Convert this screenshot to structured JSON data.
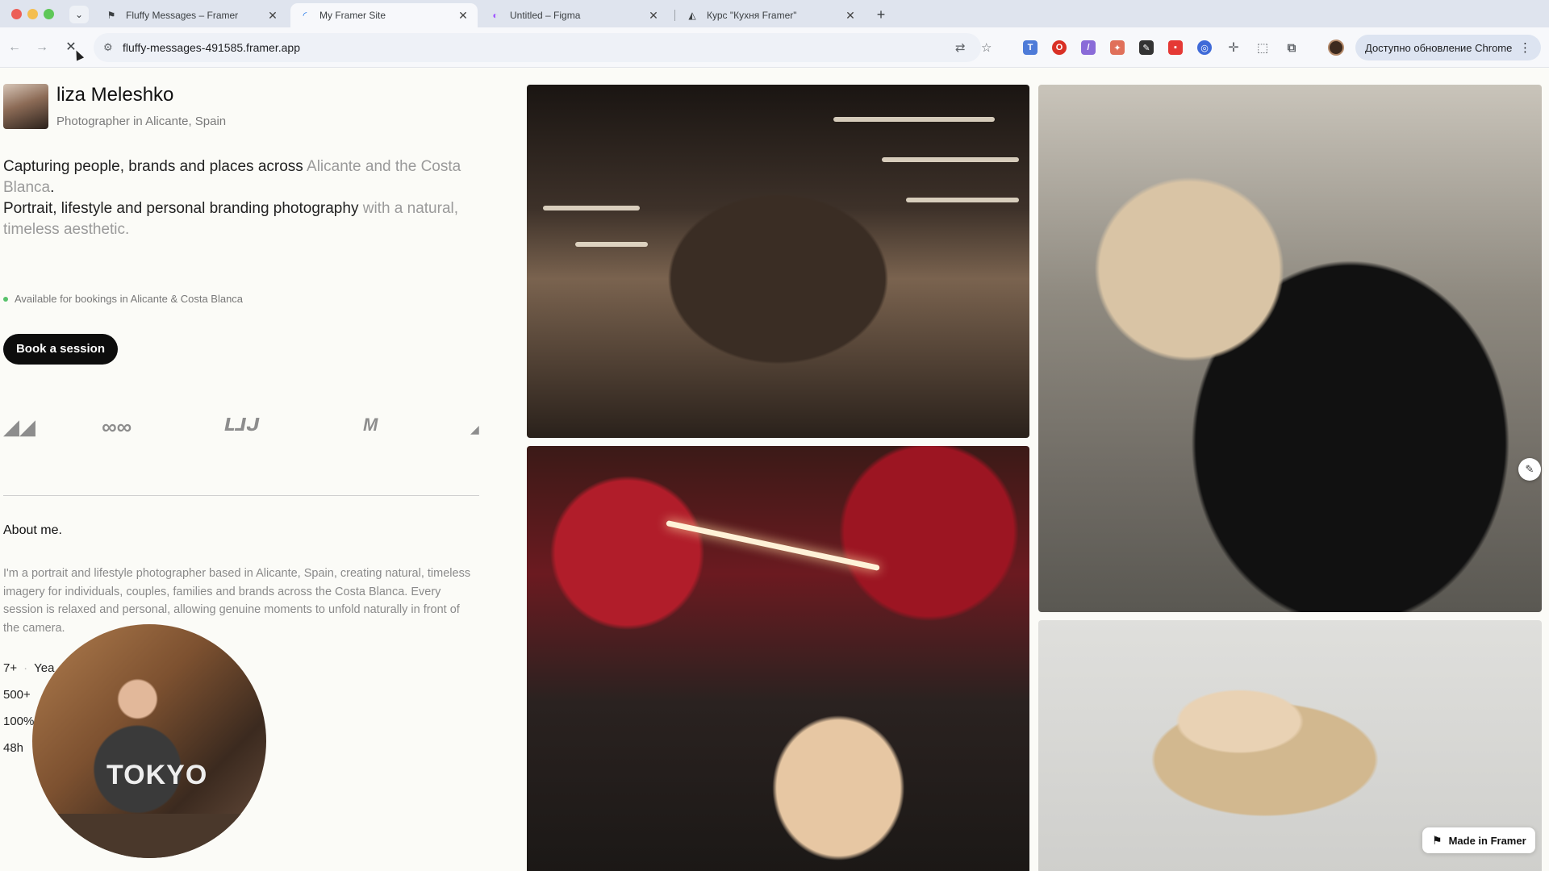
{
  "browser": {
    "tabs": [
      {
        "title": "Fluffy Messages – Framer",
        "icon": "framer-icon",
        "active": false
      },
      {
        "title": "My Framer Site",
        "icon": "loading-spinner-icon",
        "active": true
      },
      {
        "title": "Untitled – Figma",
        "icon": "figma-icon",
        "active": false
      },
      {
        "title": "Курс \"Кухня Framer\"",
        "icon": "course-icon",
        "active": false
      }
    ],
    "tab_close_glyph": "✕",
    "new_tab_glyph": "+",
    "url": "fluffy-messages-491585.framer.app",
    "update_button": "Доступно обновление Chrome",
    "update_menu_glyph": "⋮"
  },
  "profile": {
    "name": "liza Meleshko",
    "role": "Photographer in Alicante, Spain"
  },
  "intro": {
    "line1_dark": "Capturing people, brands and places across",
    "line1_muted": "Alicante and the Costa Blanca",
    "line1_end": ".",
    "line2_dark": "Portrait, lifestyle and personal branding photography",
    "line2_muted": "with a natural, timeless aesthetic."
  },
  "availability": "Available for bookings in Alicante & Costa Blanca",
  "book_button": "Book a session",
  "logos": [
    "stripe-like-logo",
    "infinity-logo",
    "wordmark-logo",
    "m-logo"
  ],
  "about": {
    "title": "About me.",
    "text": "I'm a portrait and lifestyle photographer based in Alicante, Spain, creating natural, timeless imagery for individuals, couples, families and brands across the Costa Blanca. Every session is relaxed and personal, allowing genuine moments to unfold naturally in front of the camera."
  },
  "stats": [
    {
      "value": "7+",
      "label": "Yea"
    },
    {
      "value": "500+",
      "label": ""
    },
    {
      "value": "100%",
      "label": ""
    },
    {
      "value": "48h",
      "label": ""
    }
  ],
  "webcam_shirt_text": "TOKYO",
  "made_in_framer": "Made in Framer",
  "colors": {
    "accent_dark": "#0d0d0d",
    "available_dot": "#58c26b",
    "tab_bar": "#dfe4ee"
  }
}
